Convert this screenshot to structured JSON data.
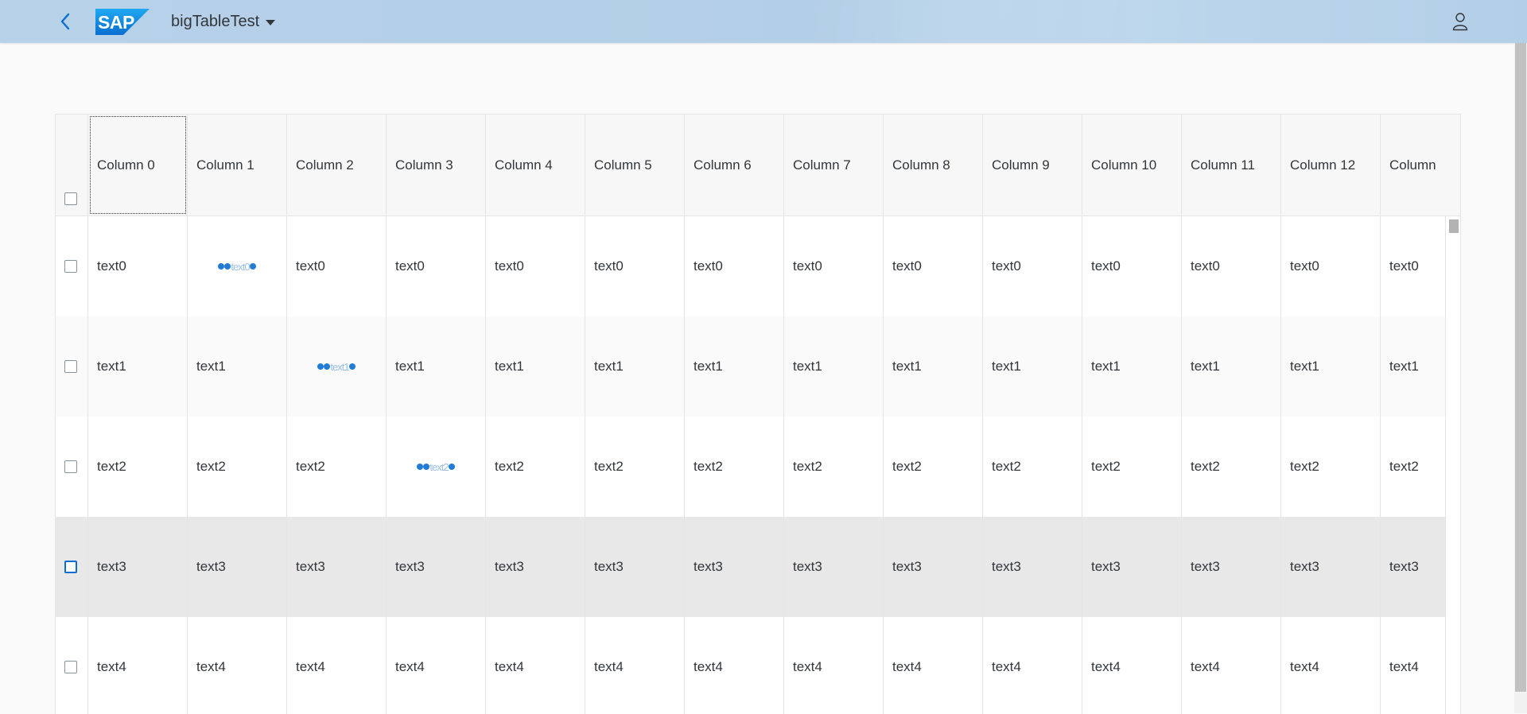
{
  "shell": {
    "app_title": "bigTableTest",
    "logo_text": "SAP",
    "brand_color": "#0a6ed1"
  },
  "table": {
    "columns": [
      "Column 0",
      "Column 1",
      "Column 2",
      "Column 3",
      "Column 4",
      "Column 5",
      "Column 6",
      "Column 7",
      "Column 8",
      "Column 9",
      "Column 10",
      "Column 11",
      "Column 12",
      "Column"
    ],
    "rows": [
      {
        "cells": [
          "text0",
          "text0",
          "text0",
          "text0",
          "text0",
          "text0",
          "text0",
          "text0",
          "text0",
          "text0",
          "text0",
          "text0",
          "text0",
          "text0"
        ],
        "busy_column": 1,
        "busy_text": "text0"
      },
      {
        "cells": [
          "text1",
          "text1",
          "text1",
          "text1",
          "text1",
          "text1",
          "text1",
          "text1",
          "text1",
          "text1",
          "text1",
          "text1",
          "text1",
          "text1"
        ],
        "busy_column": 2,
        "busy_text": "text1"
      },
      {
        "cells": [
          "text2",
          "text2",
          "text2",
          "text2",
          "text2",
          "text2",
          "text2",
          "text2",
          "text2",
          "text2",
          "text2",
          "text2",
          "text2",
          "text2"
        ],
        "busy_column": 3,
        "busy_text": "text2"
      },
      {
        "cells": [
          "text3",
          "text3",
          "text3",
          "text3",
          "text3",
          "text3",
          "text3",
          "text3",
          "text3",
          "text3",
          "text3",
          "text3",
          "text3",
          "text3"
        ],
        "busy_column": -1,
        "hovered": true
      },
      {
        "cells": [
          "text4",
          "text4",
          "text4",
          "text4",
          "text4",
          "text4",
          "text4",
          "text4",
          "text4",
          "text4",
          "text4",
          "text4",
          "text4",
          "text4"
        ],
        "busy_column": -1
      }
    ]
  },
  "icons": {
    "back": "back-icon",
    "user": "user-icon",
    "caret": "caret-down-icon"
  }
}
